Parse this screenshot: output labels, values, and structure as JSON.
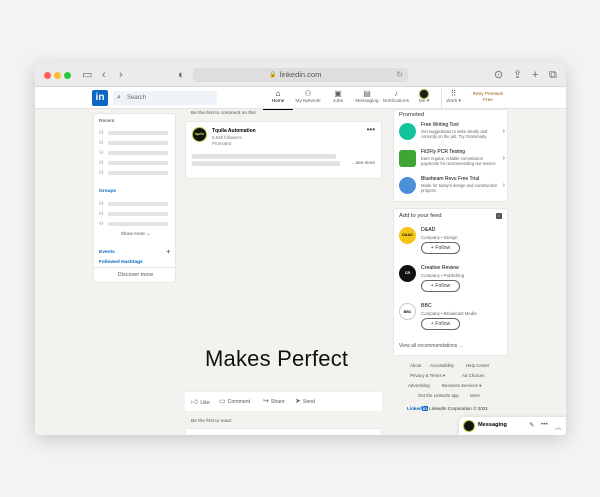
{
  "browser": {
    "url": "linkedin.com"
  },
  "nav": {
    "logo": "in",
    "search_placeholder": "Search",
    "items": [
      {
        "label": "Home",
        "icon": "home-icon",
        "glyph": "⌂"
      },
      {
        "label": "My Network",
        "icon": "network-icon",
        "glyph": "👥"
      },
      {
        "label": "Jobs",
        "icon": "briefcase-icon",
        "glyph": "💼"
      },
      {
        "label": "Messaging",
        "icon": "chat-icon",
        "glyph": "💬"
      },
      {
        "label": "Notifications",
        "icon": "bell-icon",
        "glyph": "🔔"
      }
    ],
    "me_label": "Me",
    "work_label": "Work",
    "premium_line1": "Retry Premium",
    "premium_line2": "Free"
  },
  "left": {
    "recent_title": "Recent",
    "groups_title": "Groups",
    "show_more": "Show more",
    "events": "Events",
    "hashtags": "Followed Hashtags",
    "discover": "Discover more"
  },
  "feed": {
    "comment_note": "Be the first to comment on this",
    "post": {
      "author": "Tquila Automation",
      "followers": "5,948 followers",
      "promoted": "Promoted",
      "see_more": "...see more",
      "avatar_text": "tquila"
    },
    "big_text": "Makes Perfect",
    "actions": [
      "Like",
      "Comment",
      "Share",
      "Send"
    ],
    "react_note": "Be the first to react"
  },
  "promoted": {
    "title": "Promoted",
    "ads": [
      {
        "name": "Free Writing Tool",
        "desc": "Get suggestions to write clearly and correctly on the job. Try Grammarly.",
        "color": "#15c39a"
      },
      {
        "name": "Fit2Fly PCR Testing",
        "desc": "Earn regular, reliable commission payments for recommending our service",
        "color": "#3fa535"
      },
      {
        "name": "Bluebeam Revu Free Trial",
        "desc": "Made for today's design and construction projects.",
        "color": "#4a90d9"
      }
    ]
  },
  "add_to_feed": {
    "title": "Add to your feed",
    "companies": [
      {
        "name": "D&AD",
        "sub": "Company • Design",
        "logo_color": "#f5c518",
        "logo_text": "D&AD"
      },
      {
        "name": "Creative Review",
        "sub": "Company • Publishing",
        "logo_color": "#111111",
        "logo_text": "CR"
      },
      {
        "name": "BBC",
        "sub": "Company • Broadcast Media",
        "logo_color": "#ffffff",
        "logo_text": "BBC"
      }
    ],
    "follow_label": "+ Follow",
    "view_all": "View all recommendations →"
  },
  "footer": {
    "links": [
      "About",
      "Accessibility",
      "Help Center",
      "Privacy & Terms ▾",
      "Ad Choices",
      "Advertising",
      "Business Services ▾",
      "Get the LinkedIn app",
      "More"
    ],
    "corp_logo": "Linked",
    "corp_logo_in": "in",
    "corp_text": " LinkedIn Corporation © 2021"
  },
  "messaging": {
    "label": "Messaging"
  }
}
